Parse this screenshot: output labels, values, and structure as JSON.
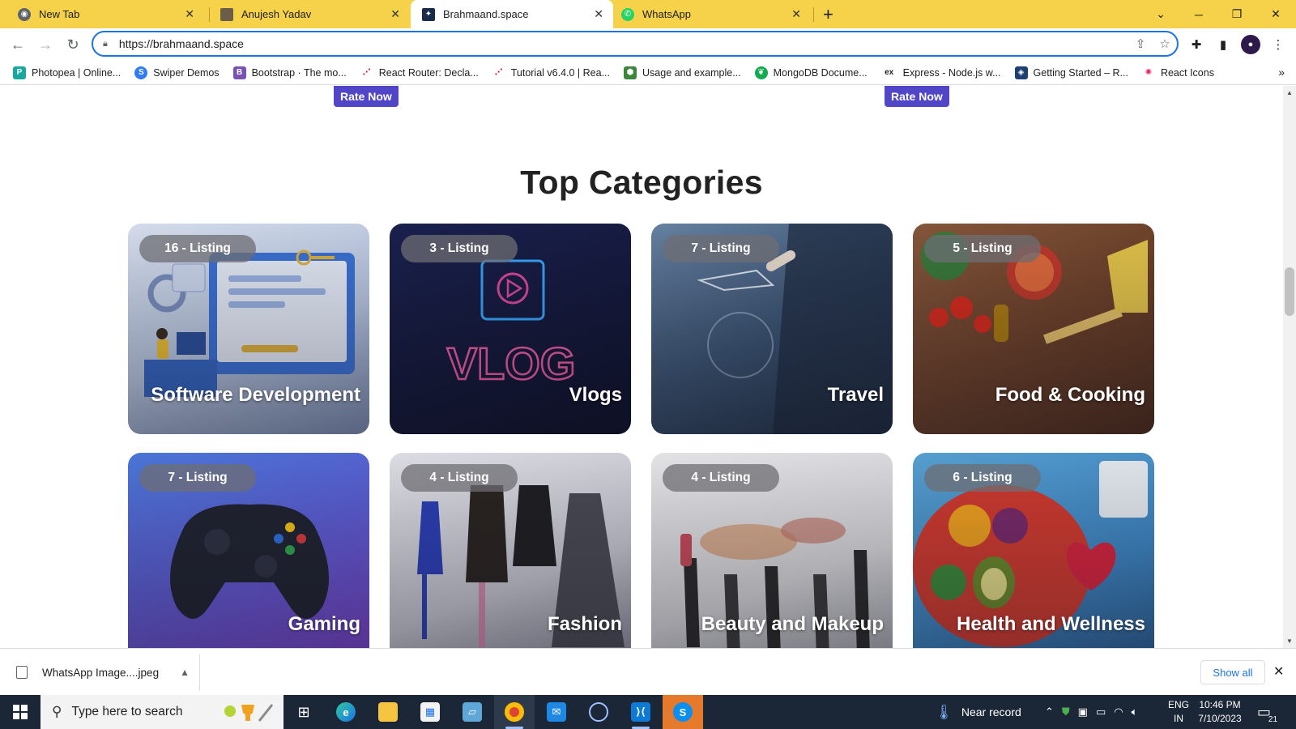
{
  "browser": {
    "tabs": [
      {
        "title": "New Tab",
        "active": false
      },
      {
        "title": "Anujesh Yadav",
        "active": false
      },
      {
        "title": "Brahmaand.space",
        "active": true
      },
      {
        "title": "WhatsApp",
        "active": false
      }
    ],
    "url": "https://brahmaand.space",
    "bookmarks": [
      "Photopea | Online...",
      "Swiper Demos",
      "Bootstrap · The mo...",
      "React Router: Decla...",
      "Tutorial v6.4.0 | Rea...",
      "Usage and example...",
      "MongoDB Docume...",
      "Express - Node.js w...",
      "Getting Started – R...",
      "React Icons"
    ],
    "bookmark_more": "»"
  },
  "page": {
    "rate_now": [
      "Rate Now",
      "Rate Now"
    ],
    "section_title": "Top Categories",
    "categories": [
      {
        "listing": "16 - Listing",
        "name": "Software Development"
      },
      {
        "listing": "3 - Listing",
        "name": "Vlogs"
      },
      {
        "listing": "7 - Listing",
        "name": "Travel"
      },
      {
        "listing": "5 - Listing",
        "name": "Food & Cooking"
      },
      {
        "listing": "7 - Listing",
        "name": "Gaming"
      },
      {
        "listing": "4 - Listing",
        "name": "Fashion"
      },
      {
        "listing": "4 - Listing",
        "name": "Beauty and Makeup"
      },
      {
        "listing": "6 - Listing",
        "name": "Health and Wellness"
      }
    ]
  },
  "download_bar": {
    "file_name": "WhatsApp Image....jpeg",
    "show_all": "Show all"
  },
  "taskbar": {
    "search_placeholder": "Type here to search",
    "weather_text": "Near record",
    "lang_top": "ENG",
    "lang_bottom": "IN",
    "time": "10:46 PM",
    "date": "7/10/2023",
    "notifications": "21"
  },
  "colors": {
    "tab_strip": "#f5d24a",
    "accent": "#1a73e8",
    "rate_button": "#5146c8",
    "taskbar": "#1b2636"
  }
}
